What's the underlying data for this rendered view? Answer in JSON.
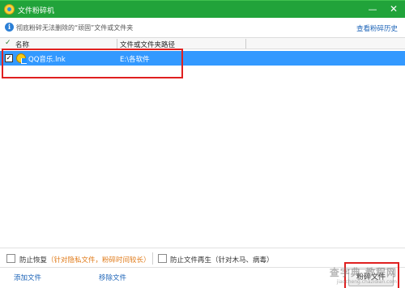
{
  "window": {
    "title": "文件粉碎机",
    "minimize_glyph": "—",
    "close_glyph": "✕"
  },
  "info": {
    "icon": "info-icon",
    "icon_glyph": "i",
    "text": "彻底粉碎无法删除的“顽固”文件或文件夹",
    "history_link": "查看粉碎历史"
  },
  "table": {
    "header_check_glyph": "✓",
    "columns": [
      "名称",
      "文件或文件夹路径"
    ],
    "rows": [
      {
        "checked": true,
        "check_glyph": "✓",
        "icon": "qq-music-icon",
        "name": "QQ音乐.lnk",
        "path": "E:\\各软件"
      }
    ]
  },
  "options": {
    "prevent_recovery_label": "防止恢复",
    "prevent_recovery_note": "（针对隐私文件，粉碎时间较长）",
    "prevent_regen_label": "防止文件再生（针对木马、病毒）"
  },
  "footer": {
    "add_label": "添加文件",
    "remove_label": "移除文件",
    "shred_label": "粉碎文件"
  },
  "watermark": {
    "main": "查字典 教程网",
    "sub": "jiaocheng.chazidian.com"
  },
  "colors": {
    "title_bar": "#21a33a",
    "selection": "#3399ff",
    "highlight": "#e02020",
    "link": "#1d64b8",
    "note": "#e07b1a"
  }
}
